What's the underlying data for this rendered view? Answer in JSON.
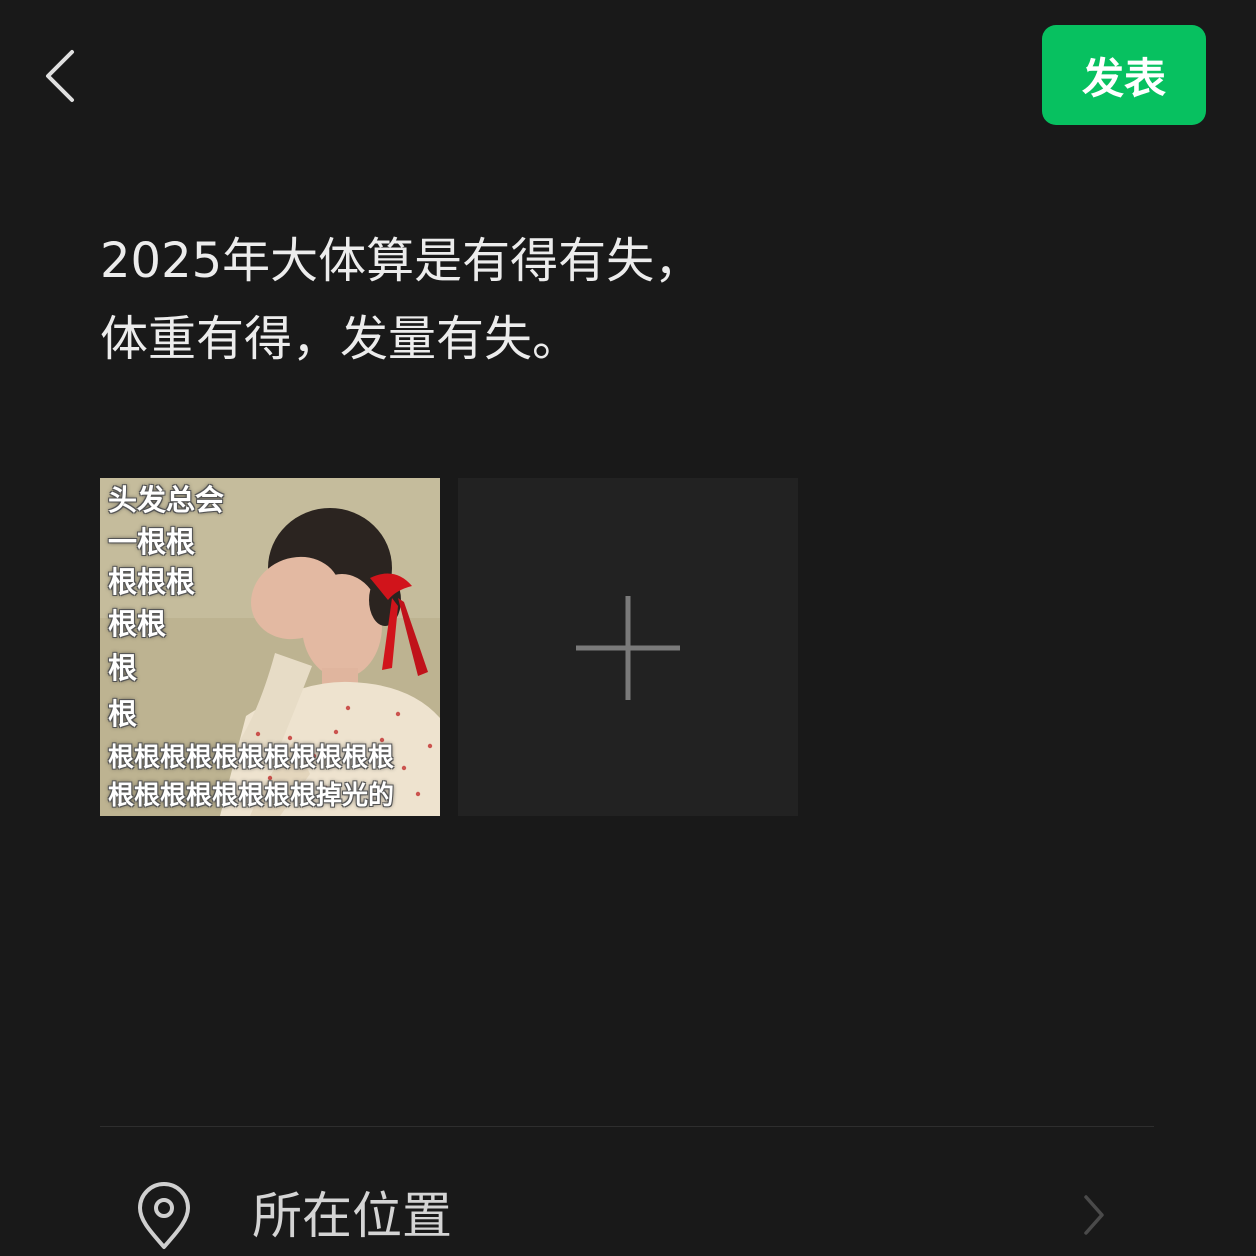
{
  "header": {
    "back_icon": "chevron-left-icon",
    "publish_label": "发表",
    "publish_color": "#07c160"
  },
  "post": {
    "lines": [
      "2025年大体算是有得有失，",
      "体重有得，发量有失。"
    ]
  },
  "media": {
    "image_caption_lines": [
      "头发总会",
      "一根根",
      "根根根",
      "根根",
      "根",
      "根",
      "根根根根根根根根根根根",
      "根根根根根根根根掉光的"
    ],
    "add_icon": "plus-icon"
  },
  "location": {
    "icon": "location-pin-icon",
    "label": "所在位置",
    "chevron_icon": "chevron-right-icon"
  }
}
